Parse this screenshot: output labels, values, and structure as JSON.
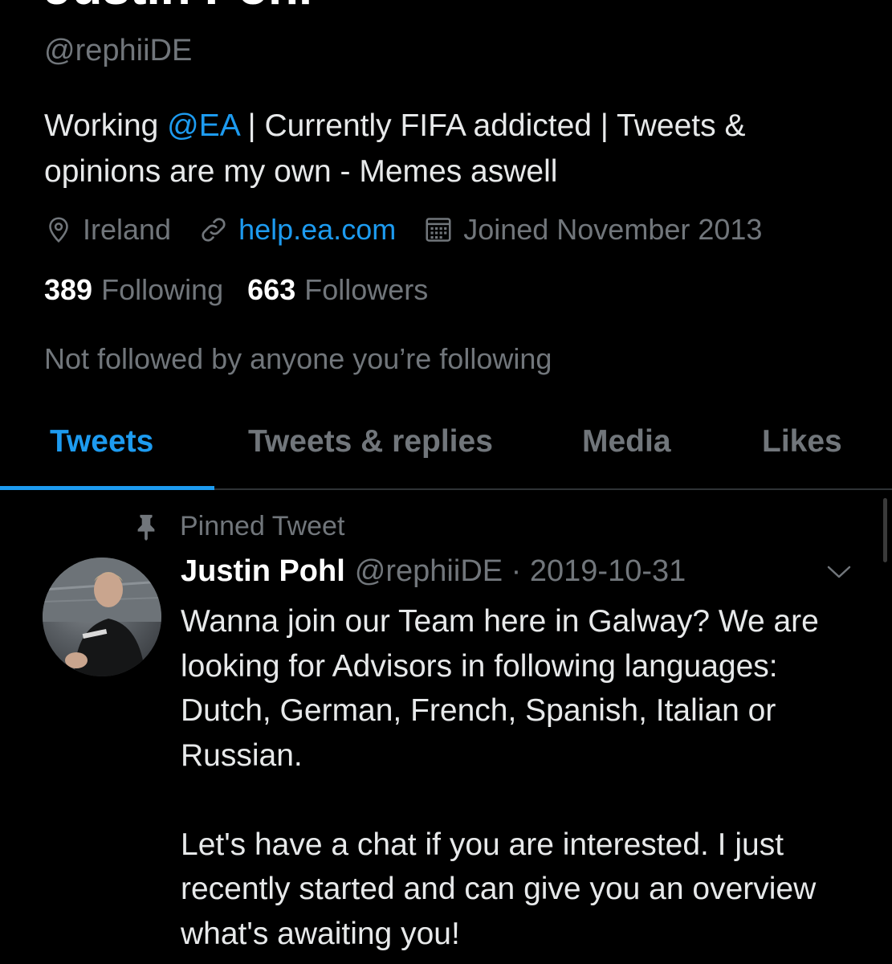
{
  "profile": {
    "name": "Justin Pohl",
    "handle": "@rephiiDE",
    "bio": {
      "prefix": "Working ",
      "mention": "@EA",
      "suffix": " | Currently FIFA addicted | Tweets & opinions are my own - Memes aswell"
    },
    "location": "Ireland",
    "website": "help.ea.com",
    "joined": "Joined November 2013",
    "following_count": "389",
    "following_label": "Following",
    "followers_count": "663",
    "followers_label": "Followers",
    "not_followed_text": "Not followed by anyone you’re following"
  },
  "tabs": [
    {
      "label": "Tweets",
      "active": true
    },
    {
      "label": "Tweets & replies",
      "active": false
    },
    {
      "label": "Media",
      "active": false
    },
    {
      "label": "Likes",
      "active": false
    }
  ],
  "pinned_tweet": {
    "pinned_label": "Pinned Tweet",
    "author_name": "Justin Pohl",
    "author_handle": "@rephiiDE",
    "separator": "·",
    "date": "2019-10-31",
    "text": "Wanna join our Team here in Galway? We are looking for Advisors in following languages: Dutch, German, French, Spanish, Italian or Russian.\n\nLet's have a chat if you are interested. I just recently started  and can give you an overview what's awaiting you!"
  },
  "icons": {
    "location": "location-pin-icon",
    "website": "link-icon",
    "joined": "calendar-icon",
    "pinned": "pin-icon",
    "tweet_menu": "chevron-down-icon"
  },
  "colors": {
    "background": "#000000",
    "accent": "#1d9bf0",
    "primary_text": "#e7e9ea",
    "secondary_text": "#71767b",
    "divider": "#2f3336"
  }
}
